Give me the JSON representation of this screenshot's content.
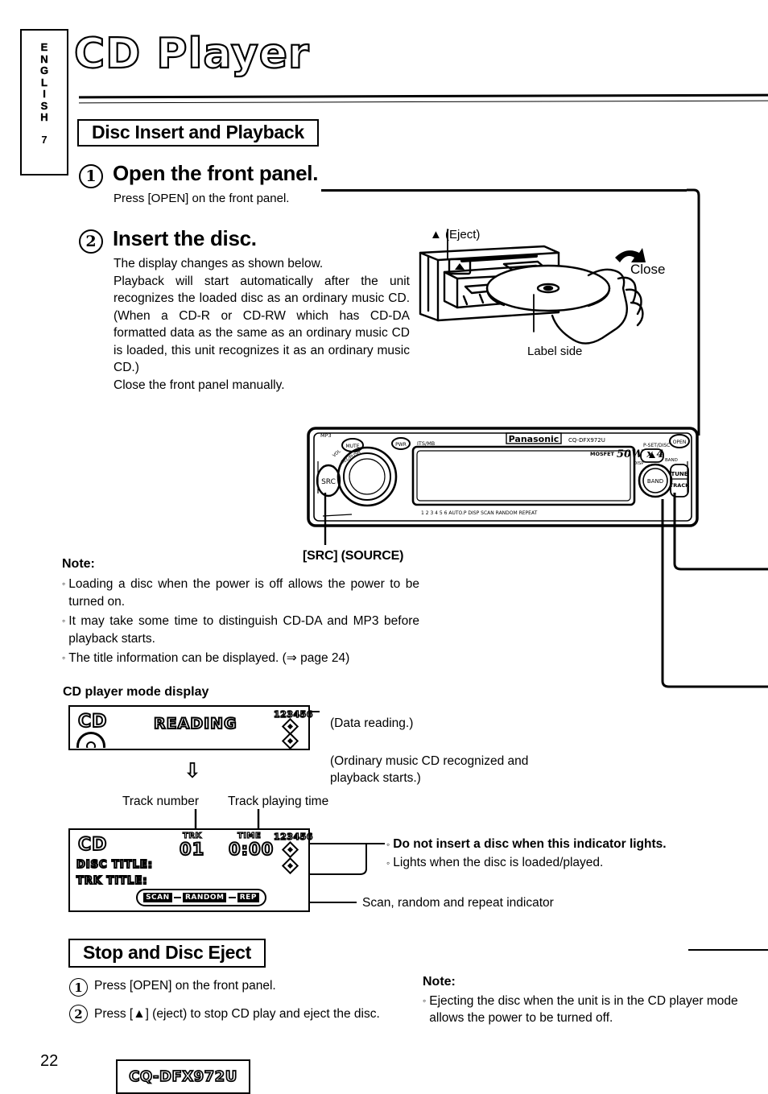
{
  "side_tab": {
    "language_letters": [
      "E",
      "N",
      "G",
      "L",
      "I",
      "S",
      "H"
    ],
    "language": "ENGLISH",
    "section_number": "7"
  },
  "header": {
    "title": "CD Player"
  },
  "sections": {
    "disc_insert": {
      "heading": "Disc Insert and Playback",
      "step1": {
        "number": "1",
        "heading": "Open the front panel.",
        "body": "Press [OPEN] on the front panel."
      },
      "step2": {
        "number": "2",
        "heading": "Insert the disc.",
        "lines": [
          "The display changes as shown below.",
          "Playback will start automatically after the unit recognizes the loaded disc as an ordinary music CD. (When a CD-R or CD-RW which has CD-DA formatted data as the same as an ordinary music CD is loaded, this unit recognizes it as an ordinary music CD.)",
          "Close the front panel manually."
        ]
      }
    },
    "stop_eject": {
      "heading": "Stop and Disc Eject",
      "step1": {
        "number": "1",
        "text": "Press [OPEN] on the front panel."
      },
      "step2": {
        "number": "2",
        "text": "Press [▲] (eject) to stop CD play and eject the disc."
      }
    }
  },
  "illustration": {
    "eject_label": "▲ (Eject)",
    "close_label": "Close",
    "label_side": "Label side",
    "eject_button_glyph": "▲"
  },
  "faceplate": {
    "brand": "Panasonic",
    "model": "CQ-DFX972U",
    "power": "MOSFET 50W x 4",
    "preset_disc": "P-SET/DISC",
    "src_button": "SRC",
    "band_button": "BAND",
    "tune_track": "TUNE\nTRACK",
    "tune_label": "TUNE",
    "track_label": "TRACK",
    "open_button": "OPEN",
    "mute_button": "MUTE",
    "pwr_button": "PWR",
    "mode_label": "MODE",
    "vol_label": "VOL",
    "src_callout": "[SRC] (SOURCE)"
  },
  "note1": {
    "heading": "Note:",
    "items": [
      "Loading a disc when the power is off allows the power to be turned on.",
      "It may take some time to distinguish CD-DA and MP3 before playback starts.",
      "The title information can be displayed. (⇒ page 24)"
    ]
  },
  "note2": {
    "heading": "Note:",
    "items": [
      "Ejecting the disc when the unit is in the CD player mode allows the power to be turned off."
    ]
  },
  "cd_mode_display": {
    "heading": "CD player mode display",
    "display1": {
      "source": "CD",
      "message": "READING",
      "disc_numbers": "123456"
    },
    "arrow": "⇩",
    "display2": {
      "source": "CD",
      "disc_title": "DISC TITLE:",
      "track_title": "TRK TITLE:",
      "track_label": "TRK",
      "track_number": "01",
      "time_label": "TIME",
      "time_value": "0:00",
      "disc_numbers": "123456",
      "indicators": [
        "SCAN",
        "RANDOM",
        "REP"
      ]
    },
    "annotations": {
      "data_reading": "(Data reading.)",
      "ordinary": "(Ordinary music CD recognized and playback starts.)",
      "track_number_label": "Track number",
      "track_time_label": "Track playing time",
      "indicator_warning": "Do not insert a disc when this indicator lights.",
      "indicator_lights": "Lights when the disc is loaded/played.",
      "scan_random_repeat": "Scan, random and repeat indicator"
    }
  },
  "footer": {
    "page_number": "22",
    "model": "CQ-DFX972U"
  },
  "colors": {
    "ink": "#000000",
    "paper": "#ffffff"
  }
}
